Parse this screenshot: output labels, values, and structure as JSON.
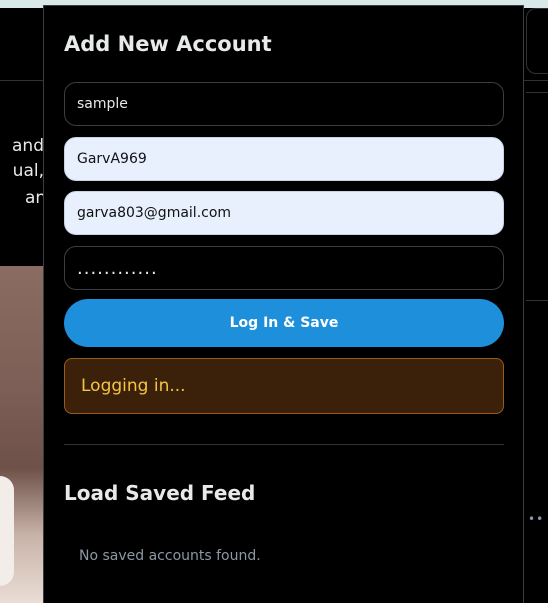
{
  "background": {
    "text_lines": [
      "and",
      "ual,",
      "and"
    ]
  },
  "form": {
    "title": "Add New Account",
    "fields": {
      "name": "sample",
      "username": "GarvA969",
      "email": "garva803@gmail.com",
      "password": "............"
    },
    "login_button": "Log In & Save",
    "status": "Logging in..."
  },
  "saved": {
    "title": "Load Saved Feed",
    "empty_message": "No saved accounts found."
  }
}
